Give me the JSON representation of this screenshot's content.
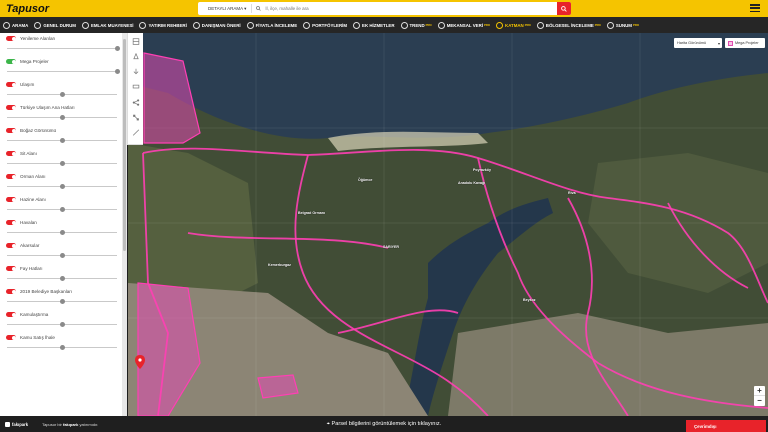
{
  "app": {
    "logo": "Tapusor"
  },
  "search": {
    "mode": "DETAYLI ARAMA ▾",
    "placeholder": "İl, ilçe, mahalle ile ara"
  },
  "nav": [
    {
      "label": "ARAMA",
      "icon": "search-icon"
    },
    {
      "label": "GENEL DURUM",
      "icon": "location-icon"
    },
    {
      "label": "EMLAK MUAYENESİ",
      "icon": "home-icon"
    },
    {
      "label": "YATIRIM REHBERİ",
      "icon": "money-icon"
    },
    {
      "label": "DANIŞMAN ÖNERİ",
      "icon": "calendar-icon"
    },
    {
      "label": "FİYATLA İNCELEME",
      "icon": "price-icon"
    },
    {
      "label": "PORTFÖYLERİM",
      "icon": "folder-icon"
    },
    {
      "label": "EK HİZMETLER",
      "icon": "services-icon"
    },
    {
      "label": "TREND",
      "icon": "trend-icon",
      "badge": "PRO"
    },
    {
      "label": "MEKANSAL VERİ",
      "icon": "geo-data-icon",
      "badge": "PRO"
    },
    {
      "label": "KATMAN",
      "icon": "layers-icon",
      "badge": "PRO"
    },
    {
      "label": "BÖLGESEL İNCELEME",
      "icon": "region-icon",
      "badge": "PRO"
    },
    {
      "label": "SUNUM",
      "icon": "presentation-icon",
      "badge": "PRO"
    }
  ],
  "layers": [
    {
      "label": "Yenileme Alanları",
      "color": "#e8232a",
      "opacity": 1.0
    },
    {
      "label": "Mega Projeler",
      "color": "#3cb54a",
      "opacity": 1.0
    },
    {
      "label": "Ulaşım",
      "color": "#e8232a",
      "opacity": 0.5
    },
    {
      "label": "Türkiye Ulaşım Ana Hatları",
      "color": "#e8232a",
      "opacity": 0.5
    },
    {
      "label": "Boğaz Görünümü",
      "color": "#e8232a",
      "opacity": 0.5
    },
    {
      "label": "Sit Alanı",
      "color": "#e8232a",
      "opacity": 0.5
    },
    {
      "label": "Orman Alanı",
      "color": "#e8232a",
      "opacity": 0.5
    },
    {
      "label": "Hazine Alanı",
      "color": "#e8232a",
      "opacity": 0.5
    },
    {
      "label": "Havalan",
      "color": "#e8232a",
      "opacity": 0.5
    },
    {
      "label": "Akarsular",
      "color": "#e8232a",
      "opacity": 0.5
    },
    {
      "label": "Fay Hatları",
      "color": "#e8232a",
      "opacity": 0.5
    },
    {
      "label": "2019 Belediye Başkanları",
      "color": "#e8232a",
      "opacity": 0.5
    },
    {
      "label": "Kamulaştırma",
      "color": "#e8232a",
      "opacity": 0.5
    },
    {
      "label": "Kamu Satış İhale",
      "color": "#e8232a",
      "opacity": 0.5
    }
  ],
  "map": {
    "basemap_label": "Harita Görünümü",
    "legend_label": "Mega Projeler",
    "labels": [
      "SARIYER",
      "Belgrad Ormanı",
      "Anadolu Kavağı",
      "Poyrazköy",
      "Riva",
      "Öğümce",
      "Beykoz",
      "Kemerburgaz"
    ],
    "zoom_in": "+",
    "zoom_out": "−"
  },
  "footer": {
    "brand": "fakıpark",
    "note_prefix": "Tapusor bir",
    "note_brand": "fakıpark",
    "note_suffix": "yatırımıdır.",
    "parsel": "Parsel bilgilerini görüntülemek için tıklayınız.",
    "whatsapp": "Çevrimdışı"
  }
}
